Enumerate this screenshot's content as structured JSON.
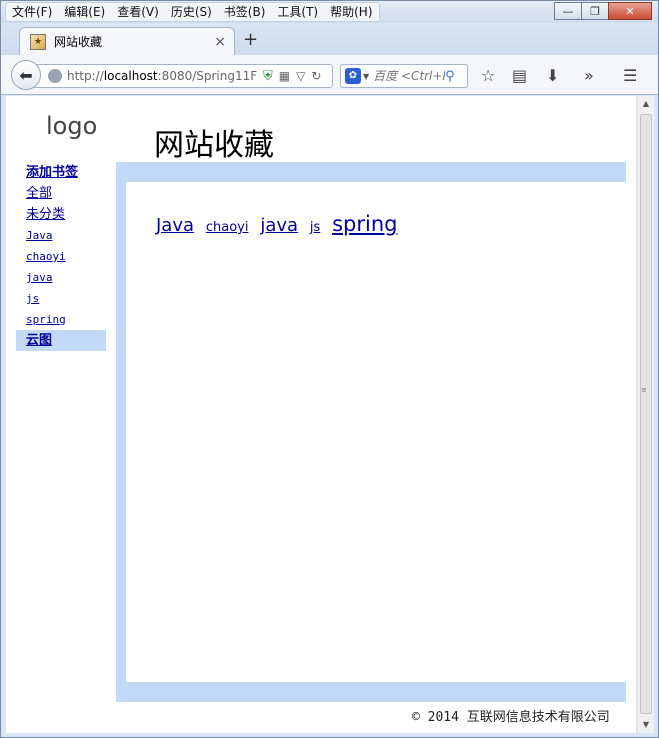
{
  "menubar": {
    "items": [
      "文件(F)",
      "编辑(E)",
      "查看(V)",
      "历史(S)",
      "书签(B)",
      "工具(T)",
      "帮助(H)"
    ]
  },
  "window_controls": {
    "minimize": "—",
    "restore": "❐",
    "close": "✕"
  },
  "tab": {
    "title": "网站收藏",
    "close": "×",
    "new_tab": "+"
  },
  "navbar": {
    "back": "⬅",
    "url_prefix": "http://",
    "url_host": "localhost",
    "url_rest": ":8080/Spring11F",
    "search_placeholder": "百度 <Ctrl+K>",
    "search_engine_icon": "baidu-paw-icon"
  },
  "page": {
    "logo": "logo",
    "title": "网站收藏",
    "sidebar": [
      {
        "label": "添加书签",
        "style": "bold"
      },
      {
        "label": "全部",
        "style": "cn"
      },
      {
        "label": "未分类",
        "style": "cn"
      },
      {
        "label": "Java",
        "style": "mono"
      },
      {
        "label": "chaoyi",
        "style": "mono"
      },
      {
        "label": "java",
        "style": "mono"
      },
      {
        "label": "js",
        "style": "mono"
      },
      {
        "label": "spring",
        "style": "mono"
      },
      {
        "label": "云图",
        "style": "active"
      }
    ],
    "tags": [
      "Java",
      "chaoyi",
      "java",
      "js",
      "spring"
    ],
    "footer_copyright": "© 2014",
    "footer_company": "互联网信息技术有限公司"
  },
  "colors": {
    "accent_frame": "#c4d8f7",
    "link": "#00009c"
  }
}
